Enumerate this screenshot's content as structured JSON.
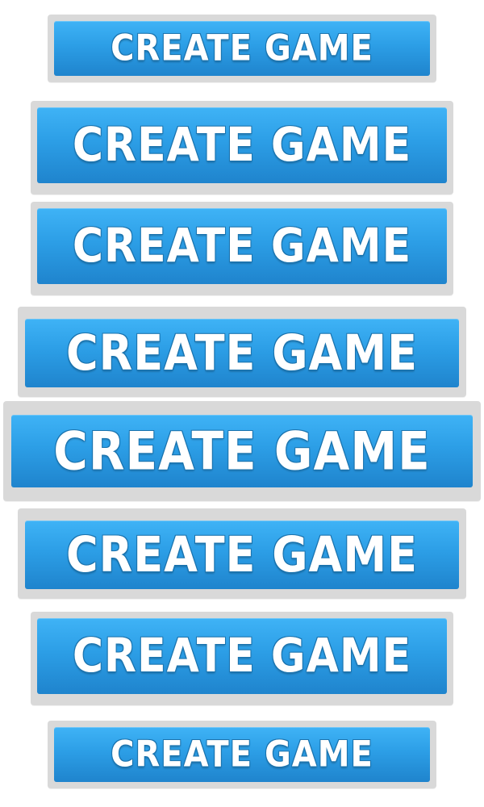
{
  "buttons": [
    {
      "label": "CREATE GAME"
    },
    {
      "label": "CREATE GAME"
    },
    {
      "label": "CREATE GAME"
    },
    {
      "label": "CREATE GAME"
    },
    {
      "label": "CREATE GAME"
    },
    {
      "label": "CREATE GAME"
    },
    {
      "label": "CREATE GAME"
    },
    {
      "label": "CREATE GAME"
    }
  ],
  "colors": {
    "frame": "#d9d9d9",
    "button_top": "#3fb3f6",
    "button_bottom": "#1f84cd",
    "label_text": "#ffffff",
    "label_outline": "#1a73ae"
  }
}
